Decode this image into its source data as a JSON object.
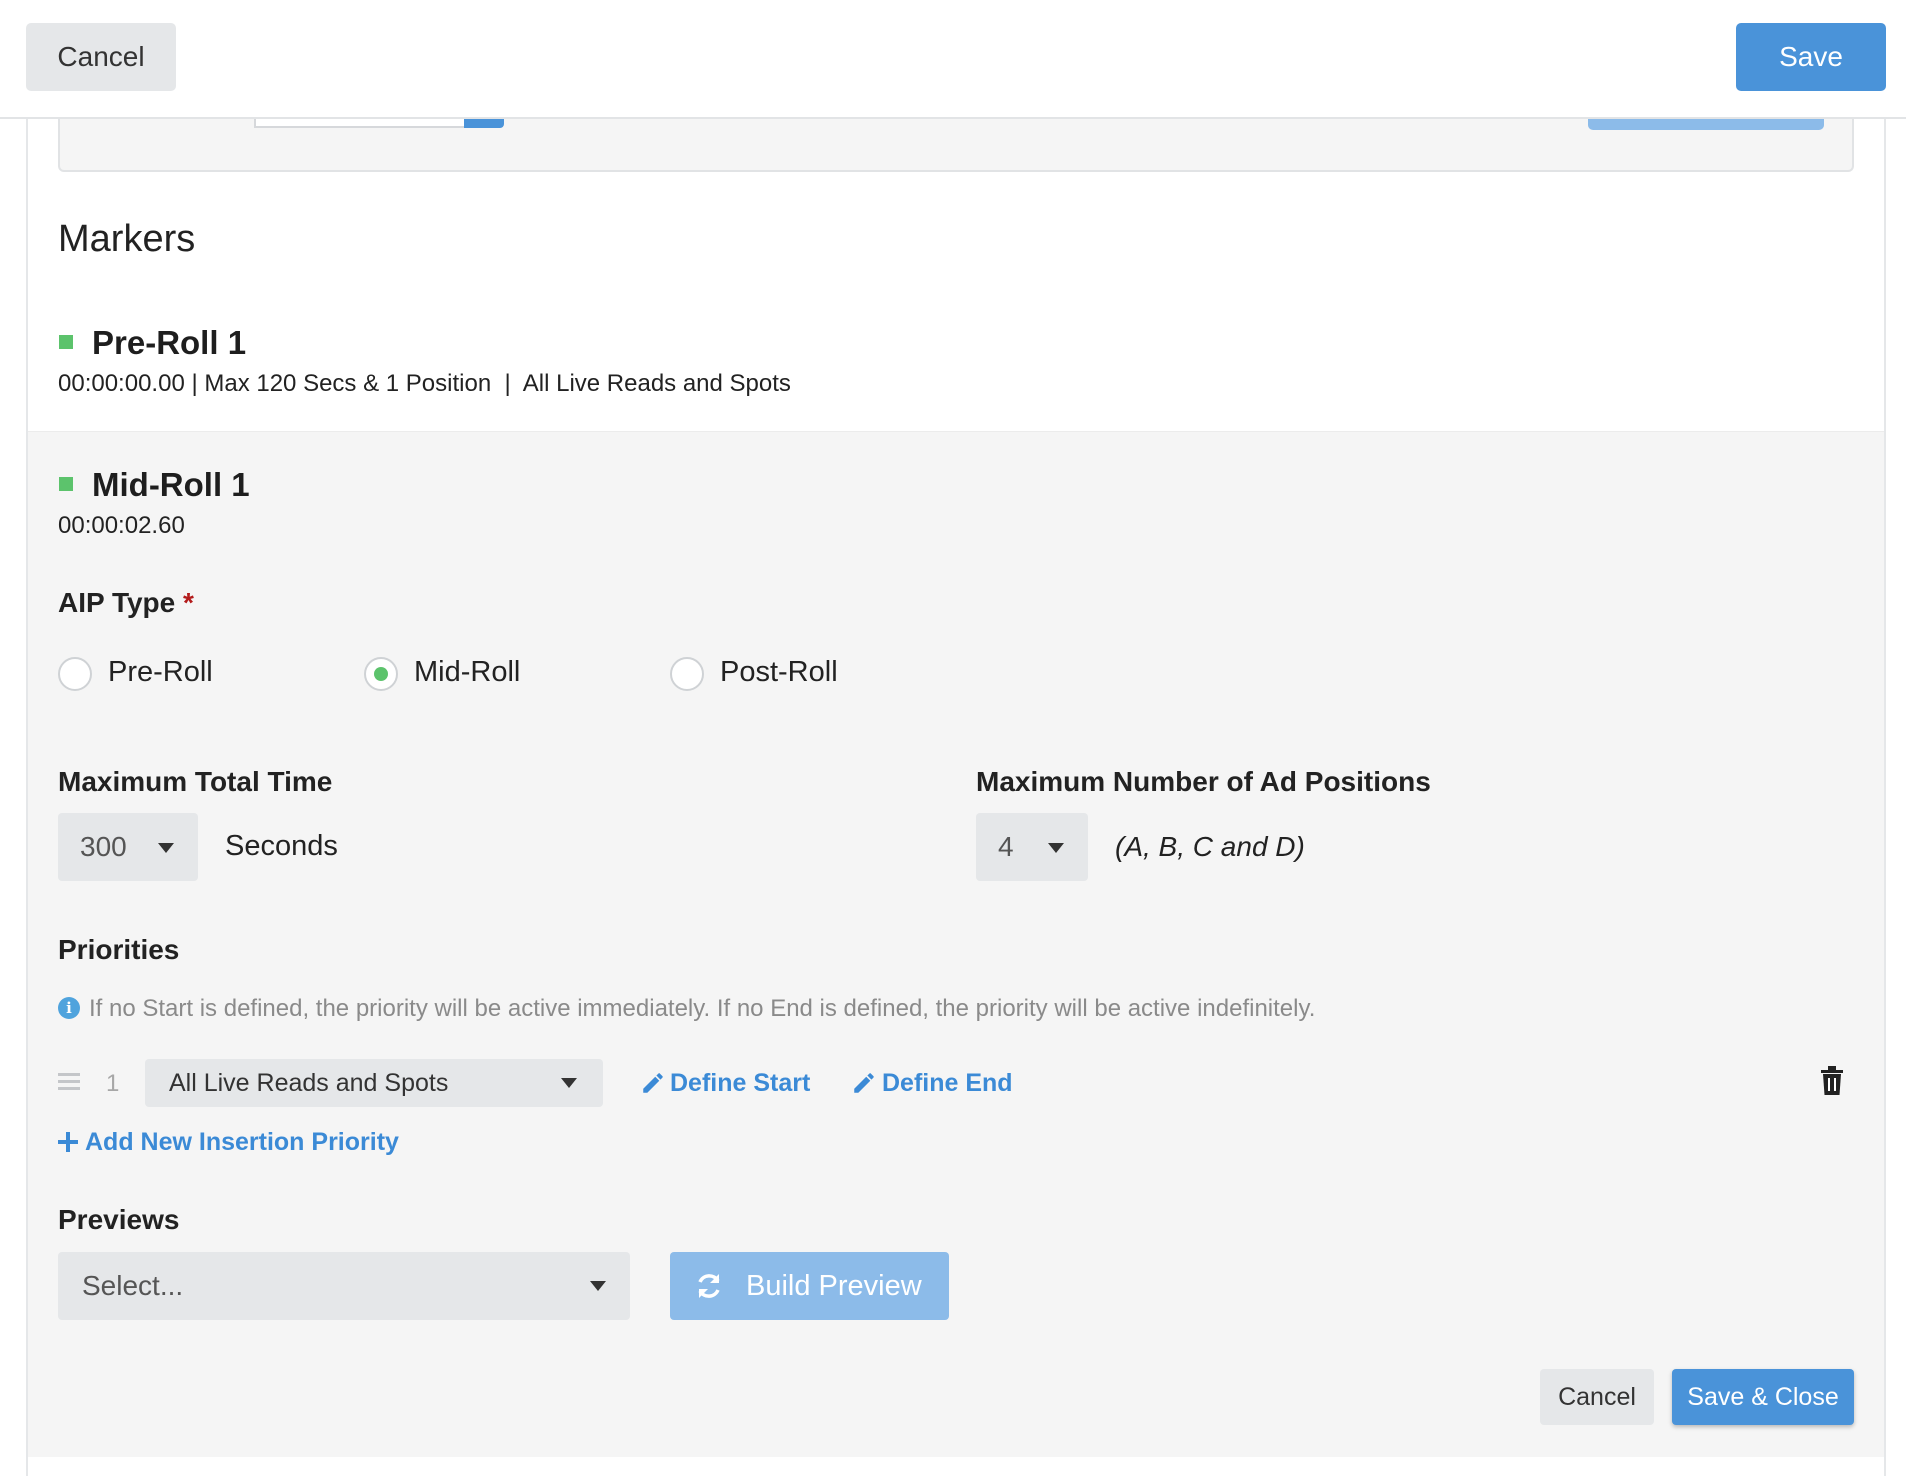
{
  "toolbar": {
    "cancel_label": "Cancel",
    "save_label": "Save"
  },
  "markers": {
    "title": "Markers",
    "pre_roll": {
      "name": "Pre-Roll 1",
      "meta": "00:00:00.00 | Max 120 Secs & 1 Position  |  All Live Reads and Spots"
    },
    "mid_roll": {
      "name": "Mid-Roll 1",
      "time": "00:00:02.60"
    }
  },
  "aip_type": {
    "label": "AIP Type",
    "required_mark": "*",
    "options": [
      "Pre-Roll",
      "Mid-Roll",
      "Post-Roll"
    ],
    "selected": "Mid-Roll"
  },
  "max_total_time": {
    "label": "Maximum Total Time",
    "value": "300",
    "unit": "Seconds"
  },
  "max_ad_positions": {
    "label": "Maximum Number of Ad Positions",
    "value": "4",
    "note": "(A, B, C and D)"
  },
  "priorities": {
    "label": "Priorities",
    "info": "If no Start is defined, the priority will be active immediately. If no End is defined, the priority will be active indefinitely.",
    "items": [
      {
        "rank": "1",
        "value": "All Live Reads and Spots",
        "define_start": "Define Start",
        "define_end": "Define End"
      }
    ],
    "add_label": "Add New Insertion Priority"
  },
  "previews": {
    "label": "Previews",
    "placeholder": "Select...",
    "build_label": "Build Preview"
  },
  "footer": {
    "cancel_label": "Cancel",
    "save_close_label": "Save & Close"
  },
  "colors": {
    "primary": "#4a93d9",
    "primary_disabled": "#8cbbe9",
    "link": "#3b8ad6",
    "marker_green": "#5cc36c",
    "required_red": "#b31b1b"
  }
}
